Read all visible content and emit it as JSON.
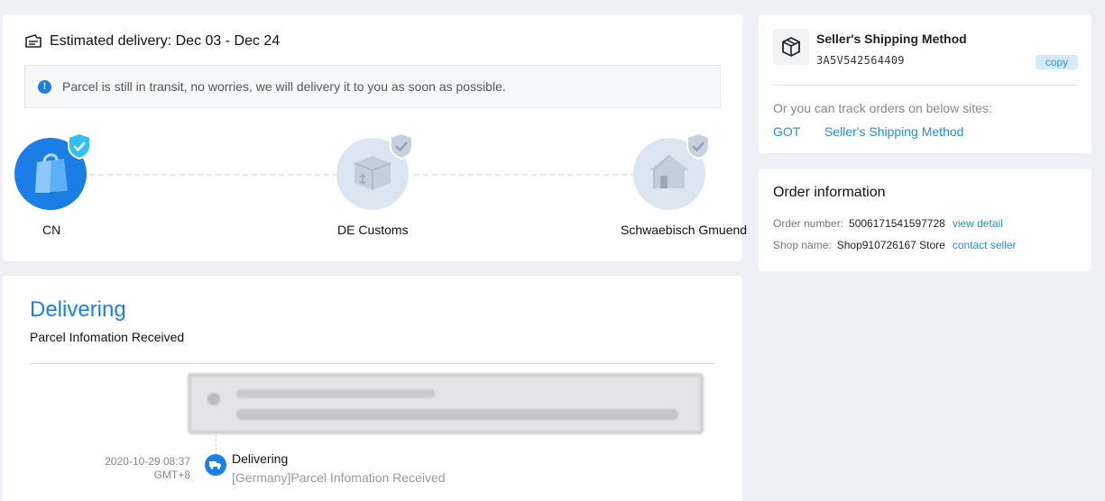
{
  "delivery": {
    "estimated_label": "Estimated delivery: Dec 03 - Dec 24",
    "notice": "Parcel is still in transit, no worries, we will delivery it to you as soon as possible.",
    "stages": [
      {
        "label": "CN",
        "state": "done"
      },
      {
        "label": "DE Customs",
        "state": "pending"
      },
      {
        "label": "Schwaebisch Gmuend",
        "state": "pending"
      }
    ]
  },
  "status": {
    "title": "Delivering",
    "subtitle": "Parcel Infomation Received",
    "timeline": [
      {
        "time": "2020-10-29 08:37",
        "tz": "GMT+8",
        "title": "Delivering",
        "detail": "[Germany]Parcel Infomation Received"
      }
    ]
  },
  "shipping": {
    "method": "Seller's Shipping Method",
    "tracking_number": "3A5V542564409",
    "copy_label": "copy",
    "track_note": "Or you can track orders on below sites:",
    "sites": [
      "GOT",
      "Seller's Shipping Method"
    ]
  },
  "order": {
    "title": "Order information",
    "number_label": "Order number:",
    "number": "5006171541597728",
    "view_detail": "view detail",
    "shop_label": "Shop name:",
    "shop": "Shop910726167 Store",
    "contact": "contact seller"
  },
  "colors": {
    "accent": "#1b7ee6",
    "link": "#2b8ccf",
    "pending_node": "#dce6f3",
    "background": "#eff0f4"
  }
}
